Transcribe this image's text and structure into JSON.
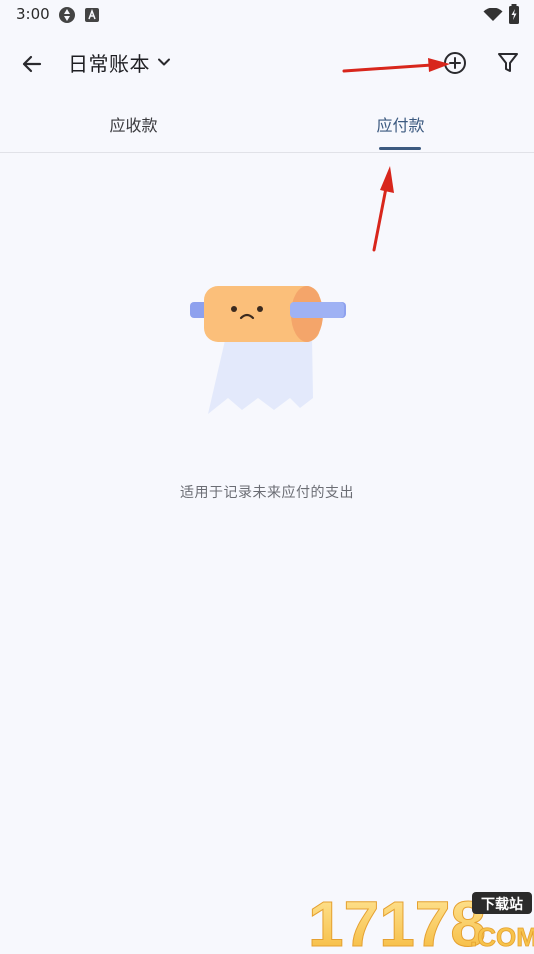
{
  "status_bar": {
    "time": "3:00",
    "icons": [
      "sync-icon",
      "a-badge-icon",
      "wifi-icon",
      "battery-charging-icon"
    ]
  },
  "app_bar": {
    "title": "日常账本",
    "icons": [
      "arrow-back-icon",
      "chevron-down-icon",
      "add-circle-icon",
      "filter-icon"
    ]
  },
  "tabs": [
    {
      "label": "应收款",
      "active": false
    },
    {
      "label": "应付款",
      "active": true
    }
  ],
  "empty_state": {
    "illustration": "empty-paper-roll-icon",
    "text": "适用于记录未来应付的支出"
  },
  "watermark": {
    "brand": "17178",
    "tag": "下载站",
    "suffix": ".COM"
  },
  "colors": {
    "background": "#f7f8fd",
    "accent": "#3c5a80",
    "annotation_arrow": "#d8261c"
  }
}
